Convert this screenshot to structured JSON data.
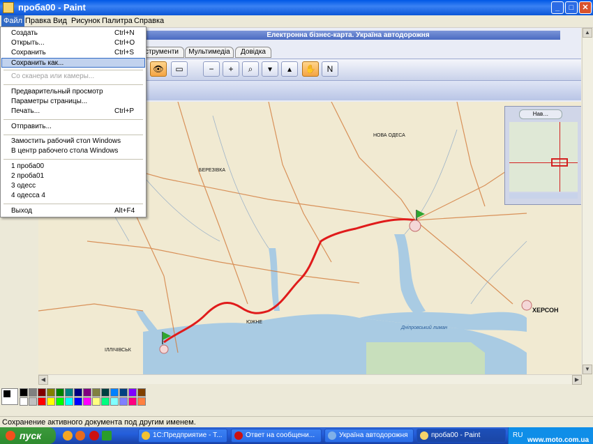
{
  "window": {
    "title": "проба00 - Paint"
  },
  "caption_buttons": {
    "minimize": "_",
    "maximize": "□",
    "close": "✕"
  },
  "menubar": [
    "Файл",
    "Правка",
    "Вид",
    "Рисунок",
    "Палитра",
    "Справка"
  ],
  "file_menu": {
    "items": [
      {
        "label": "Создать",
        "shortcut": "Ctrl+N"
      },
      {
        "label": "Открыть...",
        "shortcut": "Ctrl+O"
      },
      {
        "label": "Сохранить",
        "shortcut": "Ctrl+S"
      },
      {
        "label": "Сохранить как...",
        "shortcut": ""
      },
      {
        "label": "Со сканера или камеры...",
        "shortcut": ""
      },
      {
        "label": "Предварительный просмотр",
        "shortcut": ""
      },
      {
        "label": "Параметры страницы...",
        "shortcut": ""
      },
      {
        "label": "Печать...",
        "shortcut": "Ctrl+P"
      },
      {
        "label": "Отправить...",
        "shortcut": ""
      },
      {
        "label": "Замостить рабочий стол Windows",
        "shortcut": ""
      },
      {
        "label": "В центр рабочего стола Windows",
        "shortcut": ""
      },
      {
        "label": "1 проба00",
        "shortcut": ""
      },
      {
        "label": "2 проба01",
        "shortcut": ""
      },
      {
        "label": "3 одесс",
        "shortcut": ""
      },
      {
        "label": "4 одесса 4",
        "shortcut": ""
      },
      {
        "label": "Выход",
        "shortcut": "Alt+F4"
      }
    ]
  },
  "map_app": {
    "banner": "Електронна бізнес-карта. Україна автодорожня",
    "tabs": [
      "струменти",
      "Мультимедіа",
      "Довідка"
    ]
  },
  "map_labels": {
    "kherson": "ХЕРСОН",
    "yuzhne": "ЮЖНЕ",
    "illichivsk": "ІЛЛІЧІВСЬК",
    "berezivka": "БЕРЕЗІВКА",
    "nova_odesa": "НОВА ОДЕСА",
    "dnipro_liman": "Дніпровський лиман"
  },
  "minimap": {
    "title": "Нав…"
  },
  "statusbar": {
    "text": "Сохранение активного документа под другим именем."
  },
  "taskbar": {
    "start": "пуск",
    "tasks": [
      "1С:Предприятие - Т...",
      "Ответ на сообщени...",
      "Україна автодорожня",
      "проба00 - Paint"
    ],
    "lang": "RU"
  },
  "watermark": "www.moto.com.ua",
  "colors": {
    "titlebar": "#0058e6",
    "route": "#e01b1b",
    "menu_highlight": "#c1d2ee",
    "water": "#a9cbe3",
    "land": "#f1ead2"
  },
  "palette_colors": [
    "#000000",
    "#808080",
    "#800000",
    "#808000",
    "#008000",
    "#008080",
    "#000080",
    "#800080",
    "#808040",
    "#004040",
    "#0080ff",
    "#004080",
    "#8000ff",
    "#804000",
    "#ffffff",
    "#c0c0c0",
    "#ff0000",
    "#ffff00",
    "#00ff00",
    "#00ffff",
    "#0000ff",
    "#ff00ff",
    "#ffff80",
    "#00ff80",
    "#80ffff",
    "#8080ff",
    "#ff0080",
    "#ff8040"
  ]
}
